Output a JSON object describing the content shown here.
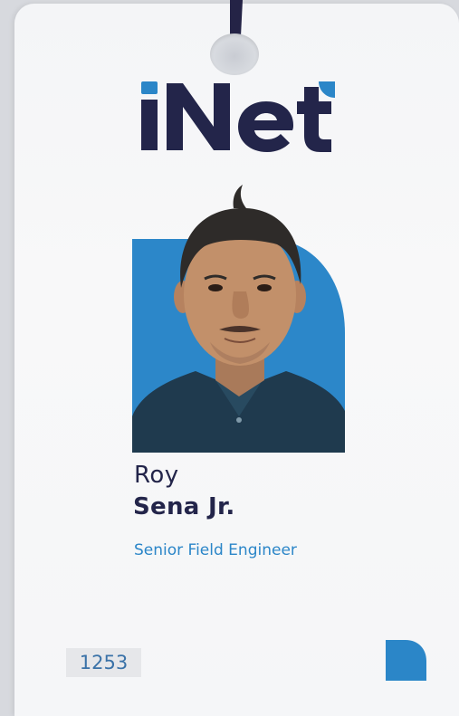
{
  "brand": {
    "name": "iNet",
    "accent_blue": "#2b86c8",
    "navy": "#23254a"
  },
  "badge": {
    "first_name": "Roy",
    "last_name": "Sena Jr.",
    "job_title": "Senior Field Engineer",
    "id_number": "1253"
  },
  "photo": {
    "icon": "employee-portrait"
  },
  "icons": {
    "corner": "brand-corner-icon",
    "lanyard": "lanyard-clip-icon"
  }
}
